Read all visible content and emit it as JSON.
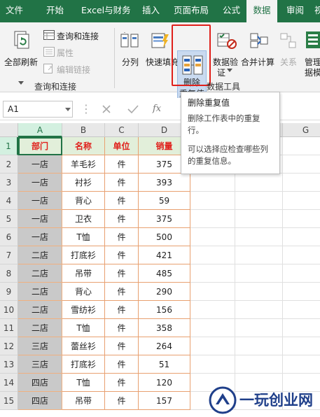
{
  "menu": {
    "tabs": [
      "文件",
      "开始",
      "Excel与财务",
      "插入",
      "页面布局",
      "公式",
      "数据",
      "审阅",
      "视"
    ],
    "active_index": 6
  },
  "ribbon": {
    "refresh_all": "全部刷新",
    "queries_connections": "查询和连接",
    "properties": "属性",
    "edit_links": "编辑链接",
    "group_queries": "查询和连接",
    "text_to_columns": "分列",
    "flash_fill": "快速填充",
    "remove_duplicates_line1": "删除",
    "remove_duplicates_line2": "重复值",
    "data_validation_line1": "数据验",
    "data_validation_line2": "证",
    "consolidate": "合并计算",
    "relationships": "关系",
    "manage_data_model_line1": "管理",
    "manage_data_model_line2": "据模",
    "group_data_tools": "数据工具"
  },
  "formula_bar": {
    "name_box": "A1",
    "fx": "fx"
  },
  "tooltip": {
    "title": "删除重复值",
    "desc": "删除工作表中的重复行。",
    "desc2": "可以选择应检查哪些列的重复信息。"
  },
  "sheet": {
    "columns": [
      "A",
      "B",
      "C",
      "D",
      "E",
      "F",
      "G"
    ],
    "rows": [
      [
        "部门",
        "名称",
        "单位",
        "销量"
      ],
      [
        "一店",
        "羊毛衫",
        "件",
        "375"
      ],
      [
        "一店",
        "衬衫",
        "件",
        "393"
      ],
      [
        "一店",
        "背心",
        "件",
        "59"
      ],
      [
        "一店",
        "卫衣",
        "件",
        "375"
      ],
      [
        "一店",
        "T恤",
        "件",
        "500"
      ],
      [
        "二店",
        "打底衫",
        "件",
        "421"
      ],
      [
        "二店",
        "吊带",
        "件",
        "485"
      ],
      [
        "二店",
        "背心",
        "件",
        "290"
      ],
      [
        "二店",
        "雪纺衫",
        "件",
        "156"
      ],
      [
        "二店",
        "T恤",
        "件",
        "358"
      ],
      [
        "三店",
        "蕾丝衫",
        "件",
        "264"
      ],
      [
        "三店",
        "打底衫",
        "件",
        "51"
      ],
      [
        "四店",
        "T恤",
        "件",
        "120"
      ],
      [
        "四店",
        "吊带",
        "件",
        "157"
      ]
    ]
  },
  "watermark": {
    "text": "一玩创业网"
  },
  "colors": {
    "excel_green": "#217346",
    "highlight_red": "#e0201b",
    "header_fill": "#e2efda",
    "col_a_fill": "#c9c9c9",
    "cell_border": "#e8a070"
  }
}
